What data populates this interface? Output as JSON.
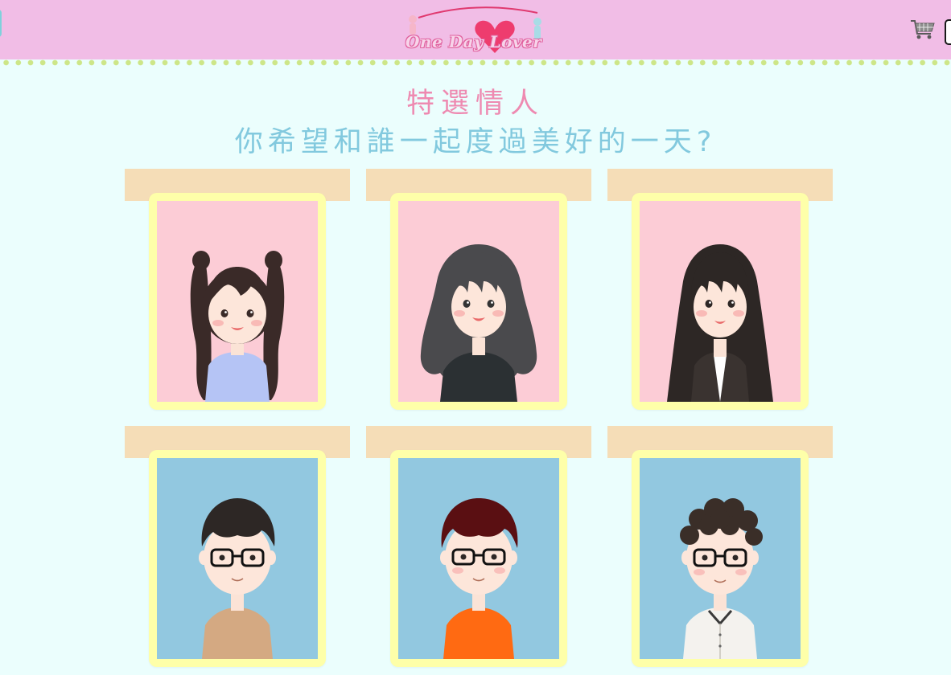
{
  "header": {
    "logo_text": "One Day Lover",
    "cart_icon": "shopping-cart-icon",
    "colors": {
      "bar": "#f1bde6",
      "dots": "#cde688"
    }
  },
  "titles": {
    "main": "特選情人",
    "sub": "你希望和誰一起度過美好的一天?"
  },
  "lovers": [
    {
      "kind": "girl",
      "style": "twin-tails",
      "shirt": "#b5c4f5",
      "bg": "#fcccd6"
    },
    {
      "kind": "girl",
      "style": "wavy",
      "shirt": "#2b3033",
      "bg": "#fcccd6"
    },
    {
      "kind": "girl",
      "style": "long-straight",
      "shirt": "#3a3330",
      "bg": "#fcccd6"
    },
    {
      "kind": "boy",
      "style": "black-hair-glasses",
      "shirt": "#d4a982",
      "bg": "#92c8e0"
    },
    {
      "kind": "boy",
      "style": "red-hair-glasses",
      "shirt": "#ff6a12",
      "bg": "#92c8e0"
    },
    {
      "kind": "boy",
      "style": "curly-hair-glasses",
      "shirt": "#f4f2ee",
      "bg": "#92c8e0"
    }
  ]
}
